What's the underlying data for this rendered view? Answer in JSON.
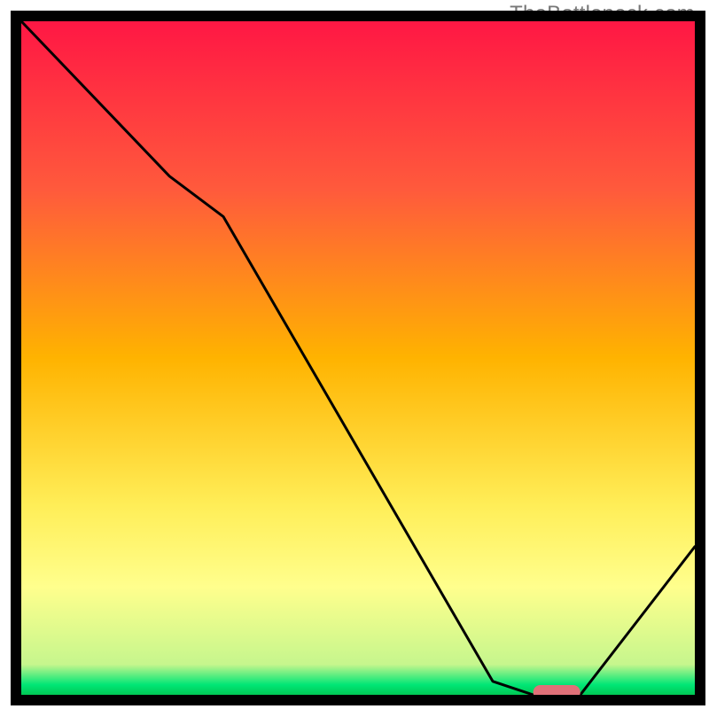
{
  "watermark": "TheBottleneck.com",
  "chart_data": {
    "type": "line",
    "title": "",
    "xlabel": "",
    "ylabel": "",
    "xlim": [
      0,
      100
    ],
    "ylim": [
      0,
      100
    ],
    "grid": false,
    "legend": false,
    "series": [
      {
        "name": "curve",
        "x": [
          0,
          22,
          30,
          70,
          76,
          83,
          100
        ],
        "values": [
          100,
          77,
          71,
          2,
          0,
          0,
          22
        ]
      }
    ],
    "marker": {
      "name": "optimal-marker",
      "x_range": [
        76,
        83
      ],
      "color": "#e07078"
    },
    "gradient_stops": [
      {
        "offset": 0.0,
        "color": "#ff1744"
      },
      {
        "offset": 0.25,
        "color": "#ff5a3c"
      },
      {
        "offset": 0.5,
        "color": "#ffb300"
      },
      {
        "offset": 0.72,
        "color": "#ffee58"
      },
      {
        "offset": 0.84,
        "color": "#ffff8d"
      },
      {
        "offset": 0.955,
        "color": "#c6f68d"
      },
      {
        "offset": 0.985,
        "color": "#00e676"
      },
      {
        "offset": 1.0,
        "color": "#00c853"
      }
    ]
  }
}
